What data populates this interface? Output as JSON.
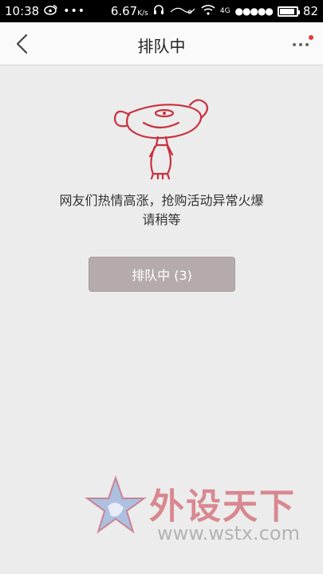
{
  "status_bar": {
    "time": "10:38",
    "speed": "6.67",
    "speed_unit": "K/s",
    "network": "4G",
    "battery": "82"
  },
  "nav": {
    "title": "排队中"
  },
  "main": {
    "message_line1": "网友们热情高涨，抢购活动异常火爆",
    "message_line2": "请稍等",
    "queue_button": "排队中 (3)"
  },
  "watermark": {
    "cn_text": "外设天下",
    "url": "www.wstx.com"
  },
  "colors": {
    "mascot_red": "#c8313f",
    "button_bg": "#b5abab",
    "notification_dot": "#e4393c"
  }
}
